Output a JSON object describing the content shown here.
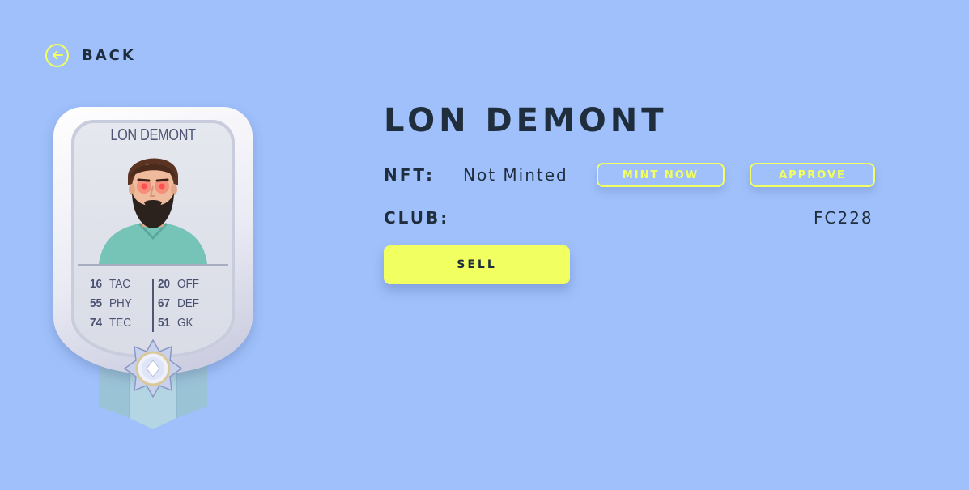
{
  "nav": {
    "back_label": "BACK"
  },
  "card": {
    "player_name": "LON DEMONT",
    "stats_left": [
      {
        "value": "16",
        "label": "TAC"
      },
      {
        "value": "55",
        "label": "PHY"
      },
      {
        "value": "74",
        "label": "TEC"
      }
    ],
    "stats_right": [
      {
        "value": "20",
        "label": "OFF"
      },
      {
        "value": "67",
        "label": "DEF"
      },
      {
        "value": "51",
        "label": "GK"
      }
    ]
  },
  "details": {
    "title": "LON DEMONT",
    "nft_label": "NFT:",
    "nft_status": "Not Minted",
    "mint_button": "MINT NOW",
    "approve_button": "APPROVE",
    "club_label": "CLUB:",
    "club_value": "FC228",
    "sell_button": "SELL"
  },
  "colors": {
    "background": "#9fc0fb",
    "accent": "#f2ff60",
    "text": "#1f2d3d"
  }
}
